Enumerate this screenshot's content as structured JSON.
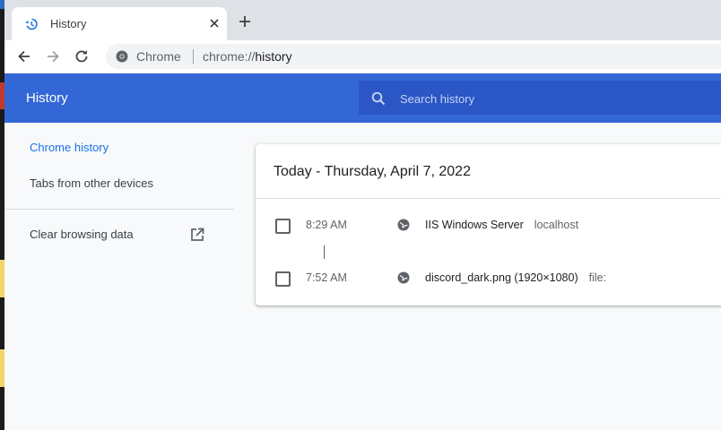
{
  "browser": {
    "tab": {
      "title": "History",
      "icon": "history-icon"
    },
    "new_tab_label": "+",
    "omnibox": {
      "site_label": "Chrome",
      "url_scheme": "chrome://",
      "url_path": "history"
    }
  },
  "header": {
    "title": "History",
    "search_placeholder": "Search history",
    "search_value": ""
  },
  "sidebar": {
    "items": [
      {
        "label": "Chrome history",
        "active": true
      },
      {
        "label": "Tabs from other devices",
        "active": false
      },
      {
        "label": "Clear browsing data",
        "active": false,
        "icon": "open-in-new-icon"
      }
    ]
  },
  "history": {
    "date_heading": "Today - Thursday, April 7, 2022",
    "entries": [
      {
        "time": "8:29 AM",
        "title": "IIS Windows Server",
        "domain": "localhost",
        "checked": false
      },
      {
        "time": "7:52 AM",
        "title": "discord_dark.png (1920×1080)",
        "domain": "file:",
        "checked": false
      }
    ]
  },
  "colors": {
    "header_bg": "#3367d6",
    "search_bg": "#2a56c6",
    "active_link": "#1a73e8",
    "page_bg": "#f8f9fa",
    "tabstrip_bg": "#dee1e6"
  }
}
